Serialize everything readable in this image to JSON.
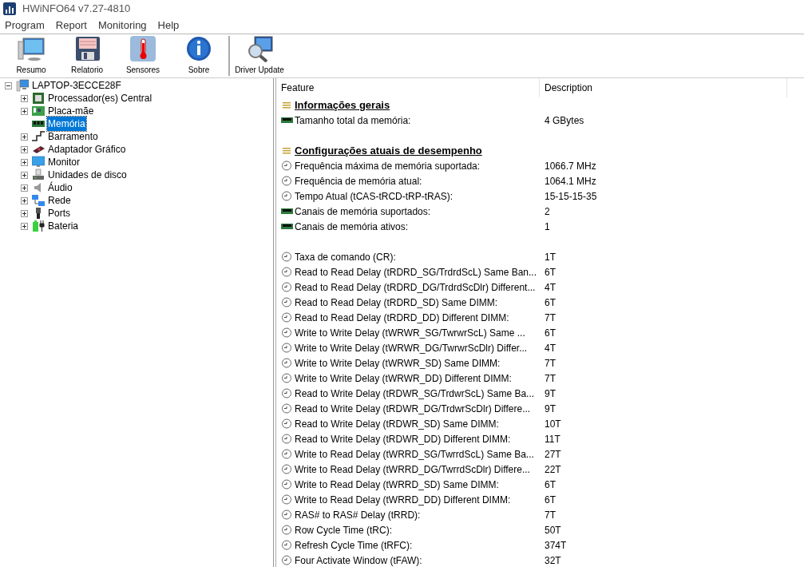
{
  "window": {
    "title": "HWiNFO64 v7.27-4810"
  },
  "menu": [
    "Program",
    "Report",
    "Monitoring",
    "Help"
  ],
  "toolbar": [
    {
      "label": "Resumo",
      "kind": "monitor",
      "separator_before": false
    },
    {
      "label": "Relatorio",
      "kind": "floppy",
      "separator_before": false
    },
    {
      "label": "Sensores",
      "kind": "thermometer",
      "separator_before": false
    },
    {
      "label": "Sobre",
      "kind": "info",
      "separator_before": false
    },
    {
      "label": "Driver Update",
      "kind": "magnifier",
      "separator_before": true
    }
  ],
  "tree": {
    "label": "LAPTOP-3ECCE28F",
    "kind": "computer",
    "has_children": true,
    "expanded": true,
    "selected": false,
    "children": [
      {
        "label": "Processador(es) Central",
        "kind": "cpu",
        "has_children": true,
        "expanded": false,
        "selected": false
      },
      {
        "label": "Placa-mãe",
        "kind": "board",
        "has_children": true,
        "expanded": false,
        "selected": false
      },
      {
        "label": "Memória",
        "kind": "memory",
        "has_children": false,
        "selected": true
      },
      {
        "label": "Barramento",
        "kind": "bus",
        "has_children": true,
        "expanded": false,
        "selected": false
      },
      {
        "label": "Adaptador Gráfico",
        "kind": "gpu",
        "has_children": true,
        "expanded": false,
        "selected": false
      },
      {
        "label": "Monitor",
        "kind": "monitor",
        "has_children": true,
        "expanded": false,
        "selected": false
      },
      {
        "label": "Unidades de disco",
        "kind": "disk",
        "has_children": true,
        "expanded": false,
        "selected": false
      },
      {
        "label": "Áudio",
        "kind": "audio",
        "has_children": true,
        "expanded": false,
        "selected": false
      },
      {
        "label": "Rede",
        "kind": "network",
        "has_children": true,
        "expanded": false,
        "selected": false
      },
      {
        "label": "Ports",
        "kind": "ports",
        "has_children": true,
        "expanded": false,
        "selected": false
      },
      {
        "label": "Bateria",
        "kind": "battery",
        "has_children": true,
        "expanded": false,
        "selected": false
      }
    ]
  },
  "table": {
    "columns": [
      "Feature",
      "Description"
    ],
    "rows": [
      {
        "kind": "section",
        "feature": "Informações gerais"
      },
      {
        "kind": "memory",
        "feature": "Tamanho total da memória:",
        "description": "4 GBytes"
      },
      {
        "kind": "blank"
      },
      {
        "kind": "section",
        "feature": "Configurações atuais de desempenho"
      },
      {
        "kind": "clock",
        "feature": "Frequência máxima de memória suportada:",
        "description": "1066.7 MHz"
      },
      {
        "kind": "clock",
        "feature": "Frequência de memória atual:",
        "description": "1064.1 MHz"
      },
      {
        "kind": "clock",
        "feature": "Tempo Atual (tCAS-tRCD-tRP-tRAS):",
        "description": "15-15-15-35"
      },
      {
        "kind": "memory",
        "feature": "Canais de memória suportados:",
        "description": "2"
      },
      {
        "kind": "memory",
        "feature": "Canais de memória ativos:",
        "description": "1"
      },
      {
        "kind": "blank"
      },
      {
        "kind": "clock",
        "feature": "Taxa de comando (CR):",
        "description": "1T"
      },
      {
        "kind": "clock",
        "feature": "Read to Read Delay (tRDRD_SG/TrdrdScL) Same Ban...",
        "description": "6T"
      },
      {
        "kind": "clock",
        "feature": "Read to Read Delay (tRDRD_DG/TrdrdScDlr) Different...",
        "description": "4T"
      },
      {
        "kind": "clock",
        "feature": "Read to Read Delay (tRDRD_SD) Same DIMM:",
        "description": "6T"
      },
      {
        "kind": "clock",
        "feature": "Read to Read Delay (tRDRD_DD) Different DIMM:",
        "description": "7T"
      },
      {
        "kind": "clock",
        "feature": "Write to Write Delay (tWRWR_SG/TwrwrScL) Same ...",
        "description": "6T"
      },
      {
        "kind": "clock",
        "feature": "Write to Write Delay (tWRWR_DG/TwrwrScDlr) Differ...",
        "description": "4T"
      },
      {
        "kind": "clock",
        "feature": "Write to Write Delay (tWRWR_SD) Same DIMM:",
        "description": "7T"
      },
      {
        "kind": "clock",
        "feature": "Write to Write Delay (tWRWR_DD) Different DIMM:",
        "description": "7T"
      },
      {
        "kind": "clock",
        "feature": "Read to Write Delay (tRDWR_SG/TrdwrScL) Same Ba...",
        "description": "9T"
      },
      {
        "kind": "clock",
        "feature": "Read to Write Delay (tRDWR_DG/TrdwrScDlr) Differe...",
        "description": "9T"
      },
      {
        "kind": "clock",
        "feature": "Read to Write Delay (tRDWR_SD) Same DIMM:",
        "description": "10T"
      },
      {
        "kind": "clock",
        "feature": "Read to Write Delay (tRDWR_DD) Different DIMM:",
        "description": "11T"
      },
      {
        "kind": "clock",
        "feature": "Write to Read Delay (tWRRD_SG/TwrrdScL) Same Ba...",
        "description": "27T"
      },
      {
        "kind": "clock",
        "feature": "Write to Read Delay (tWRRD_DG/TwrrdScDlr) Differe...",
        "description": "22T"
      },
      {
        "kind": "clock",
        "feature": "Write to Read Delay (tWRRD_SD) Same DIMM:",
        "description": "6T"
      },
      {
        "kind": "clock",
        "feature": "Write to Read Delay (tWRRD_DD) Different DIMM:",
        "description": "6T"
      },
      {
        "kind": "clock",
        "feature": "RAS# to RAS# Delay (tRRD):",
        "description": "7T"
      },
      {
        "kind": "clock",
        "feature": "Row Cycle Time (tRC):",
        "description": "50T"
      },
      {
        "kind": "clock",
        "feature": "Refresh Cycle Time (tRFC):",
        "description": "374T"
      },
      {
        "kind": "clock",
        "feature": "Four Activate Window (tFAW):",
        "description": "32T"
      }
    ]
  }
}
